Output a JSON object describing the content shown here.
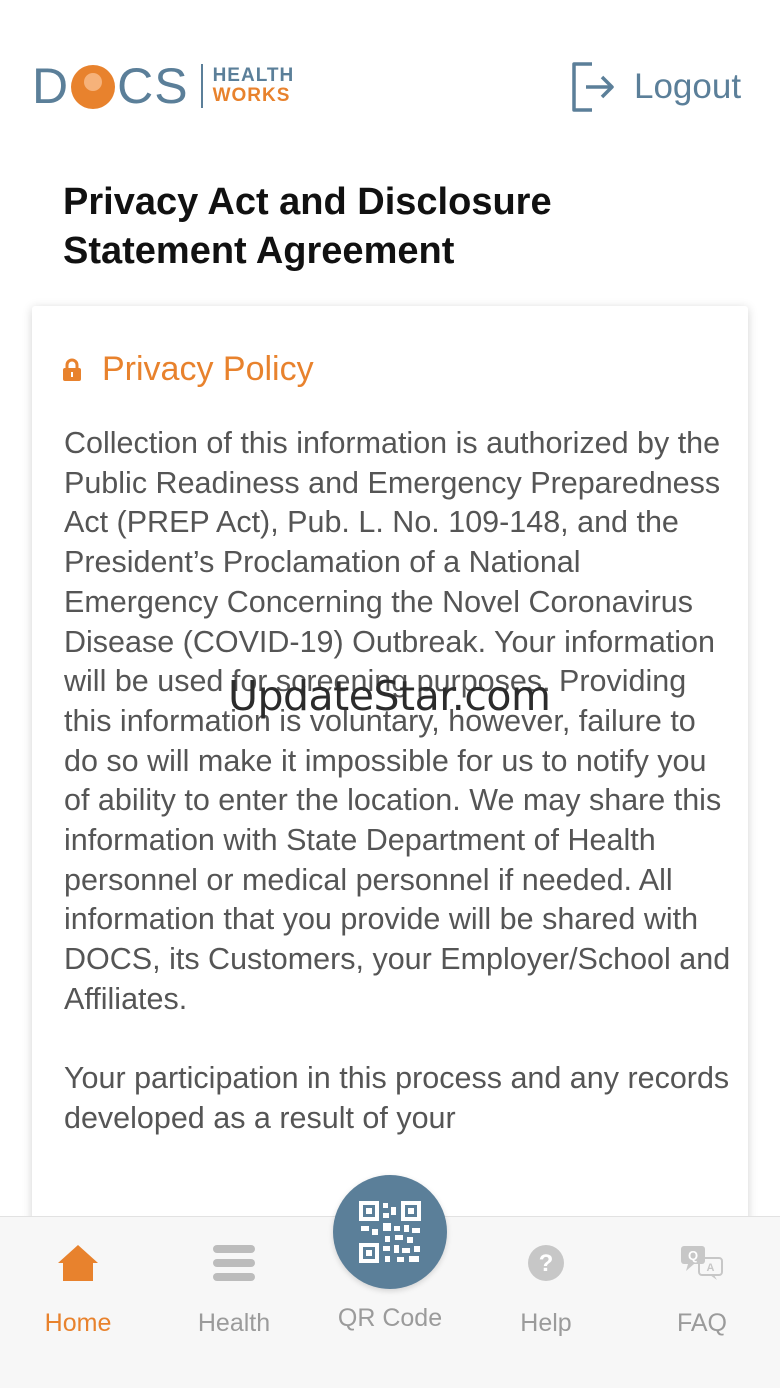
{
  "header": {
    "logo": {
      "docs_text": "DOCS",
      "health_text": "HEALTH",
      "works_text": "WORKS"
    },
    "logout_label": "Logout",
    "logout_icon": "logout-icon"
  },
  "page": {
    "title": "Privacy Act and Disclosure Statement Agreement"
  },
  "card": {
    "heading": "Privacy Policy",
    "heading_icon": "lock-icon",
    "paragraphs": [
      "Collection of this information is authorized by the Public Readiness and Emergency Preparedness Act (PREP Act), Pub. L. No. 109-148, and the President’s Proclamation of a National Emergency Concerning the Novel Coronavirus Disease (COVID-19) Outbreak. Your information will be used for screening purposes. Providing this information is voluntary, however, failure to do so will make it impossible for us to notify you of ability to enter the location. We may share this information with State Department of Health personnel or medical personnel if needed. All information that you provide will be shared with DOCS, its Customers, your Employer/School and Affiliates.",
      "Your participation in this process and any records developed as a result of your"
    ]
  },
  "watermark": "UpdateStar.com",
  "tabbar": {
    "tabs": [
      {
        "label": "Home",
        "icon": "home-icon",
        "active": true
      },
      {
        "label": "Health",
        "icon": "list-icon",
        "active": false
      },
      {
        "label": "QR Code",
        "icon": "qr-code-icon",
        "active": false
      },
      {
        "label": "Help",
        "icon": "help-icon",
        "active": false
      },
      {
        "label": "FAQ",
        "icon": "faq-icon",
        "active": false
      }
    ]
  },
  "colors": {
    "brand_blue": "#5b7f99",
    "brand_orange": "#e8822d",
    "inactive_gray": "#9b9b9b"
  }
}
